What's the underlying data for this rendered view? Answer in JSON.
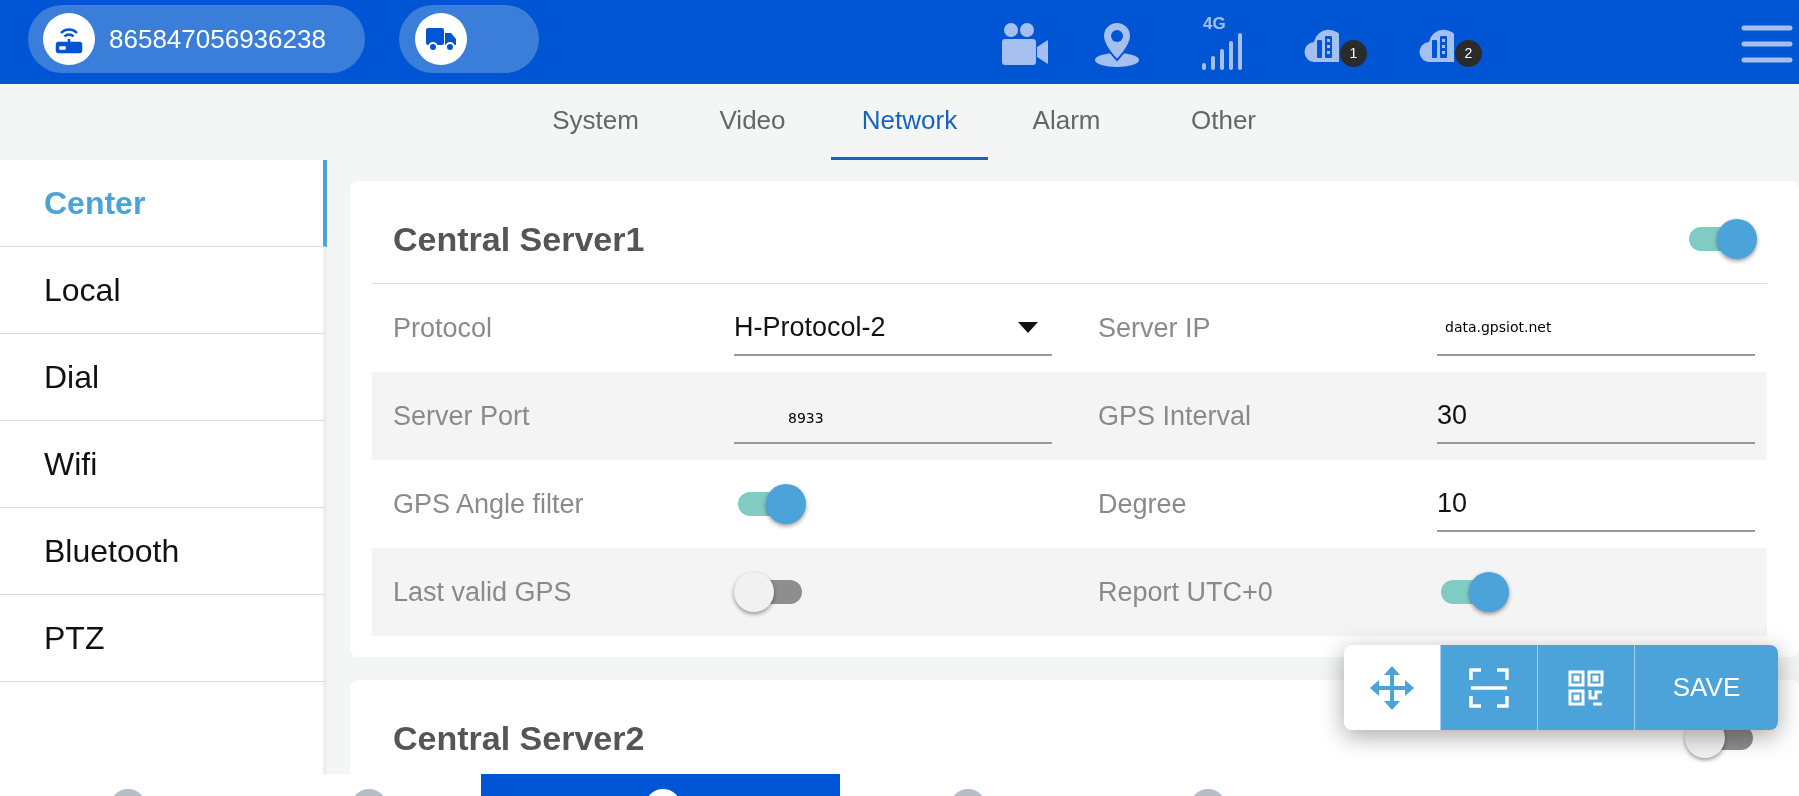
{
  "top_bar": {
    "device_id": "865847056936238",
    "status_icons": [
      {
        "kind": "camera"
      },
      {
        "kind": "location"
      },
      {
        "kind": "signal",
        "label": "4G"
      },
      {
        "kind": "cloud",
        "badge": "1"
      },
      {
        "kind": "cloud",
        "badge": "2"
      }
    ]
  },
  "tabs": [
    {
      "label": "System",
      "selected": false
    },
    {
      "label": "Video",
      "selected": false
    },
    {
      "label": "Network",
      "selected": true
    },
    {
      "label": "Alarm",
      "selected": false
    },
    {
      "label": "Other",
      "selected": false
    }
  ],
  "sidebar": {
    "items": [
      {
        "label": "Center",
        "selected": true
      },
      {
        "label": "Local",
        "selected": false
      },
      {
        "label": "Dial",
        "selected": false
      },
      {
        "label": "Wifi",
        "selected": false
      },
      {
        "label": "Bluetooth",
        "selected": false
      },
      {
        "label": "PTZ",
        "selected": false
      }
    ]
  },
  "servers": [
    {
      "title": "Central Server1",
      "on": true,
      "rows": [
        [
          {
            "label": "Protocol",
            "kind": "select",
            "value": "H-Protocol-2"
          },
          {
            "label": "Server IP",
            "kind": "raw",
            "value": "data.gpsiot.net"
          }
        ],
        [
          {
            "label": "Server Port",
            "kind": "raw",
            "value": "8933"
          },
          {
            "label": "GPS Interval",
            "kind": "input",
            "value": "30"
          }
        ],
        [
          {
            "label": "GPS Angle filter",
            "kind": "toggle",
            "on": true
          },
          {
            "label": "Degree",
            "kind": "input",
            "value": "10"
          }
        ],
        [
          {
            "label": "Last valid GPS",
            "kind": "toggle",
            "on": false
          },
          {
            "label": "Report UTC+0",
            "kind": "toggle",
            "on": true
          }
        ]
      ]
    },
    {
      "title": "Central Server2",
      "on": false
    }
  ],
  "toolbar": [
    {
      "kind": "move"
    },
    {
      "kind": "scan"
    },
    {
      "kind": "qr"
    },
    {
      "kind": "text",
      "label": "SAVE"
    }
  ],
  "bottom_nav": [
    {
      "selected": false
    },
    {
      "selected": false
    },
    {
      "selected": true
    },
    {
      "selected": false
    },
    {
      "selected": false
    }
  ]
}
